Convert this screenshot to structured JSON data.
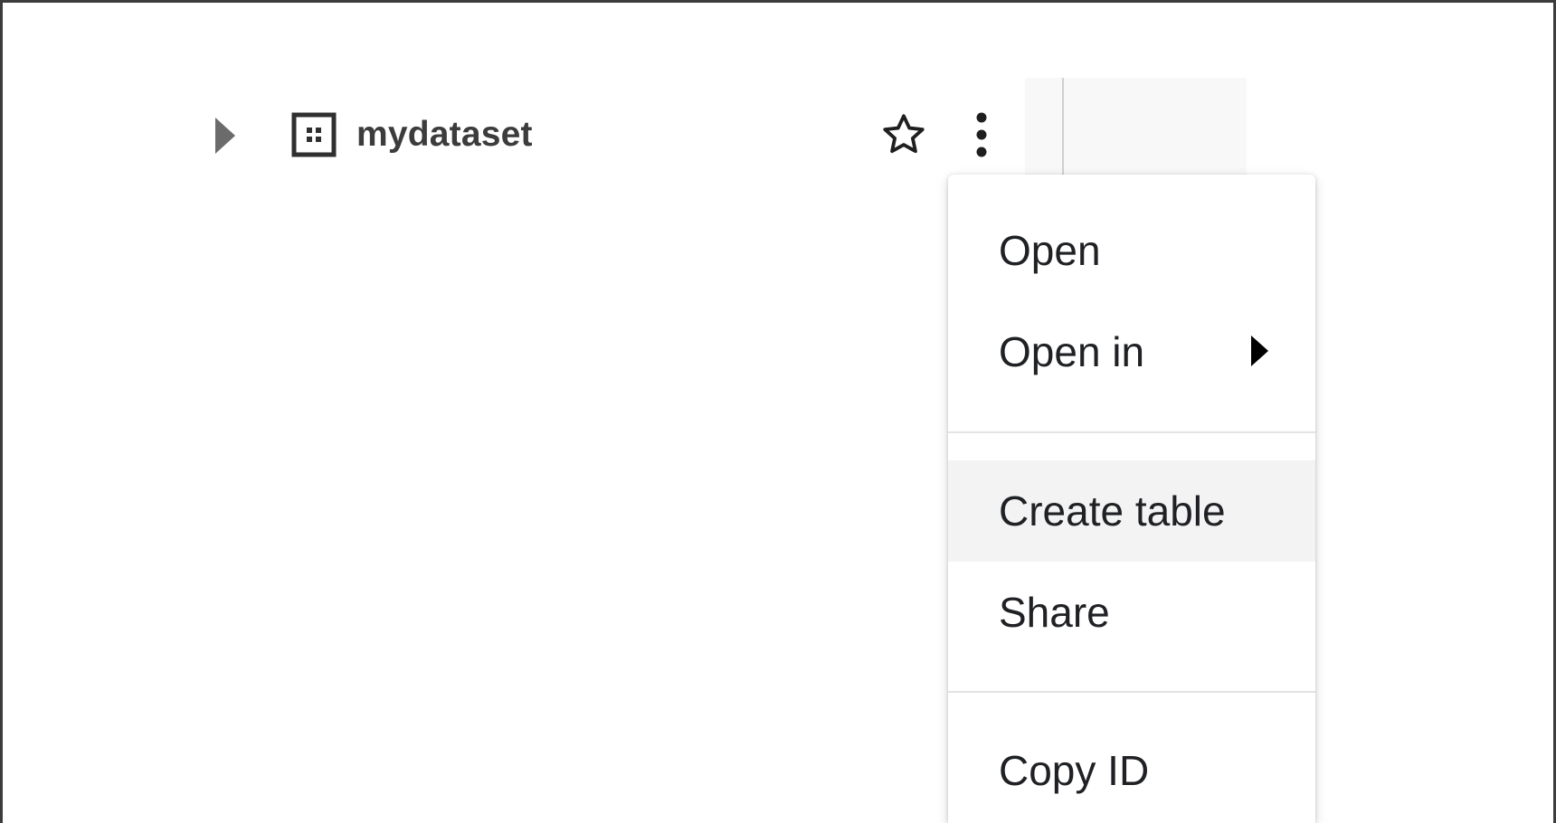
{
  "tree": {
    "dataset_name": "mydataset",
    "icons": {
      "expand": "caret-right-icon",
      "dataset": "dataset-grid-icon",
      "star": "star-outline-icon",
      "more": "more-vertical-icon"
    }
  },
  "context_menu": {
    "items": [
      {
        "label": "Open"
      },
      {
        "label": "Open in"
      },
      {
        "label": "Create table"
      },
      {
        "label": "Share"
      },
      {
        "label": "Copy ID"
      }
    ],
    "highlighted_item": "Create table",
    "icons": {
      "submenu": "caret-right-icon"
    }
  },
  "colors": {
    "menu_highlight": "#f3f3f3",
    "divider": "#e3e3e3",
    "text": "#202124",
    "dataset_text": "#3c3c3c"
  }
}
